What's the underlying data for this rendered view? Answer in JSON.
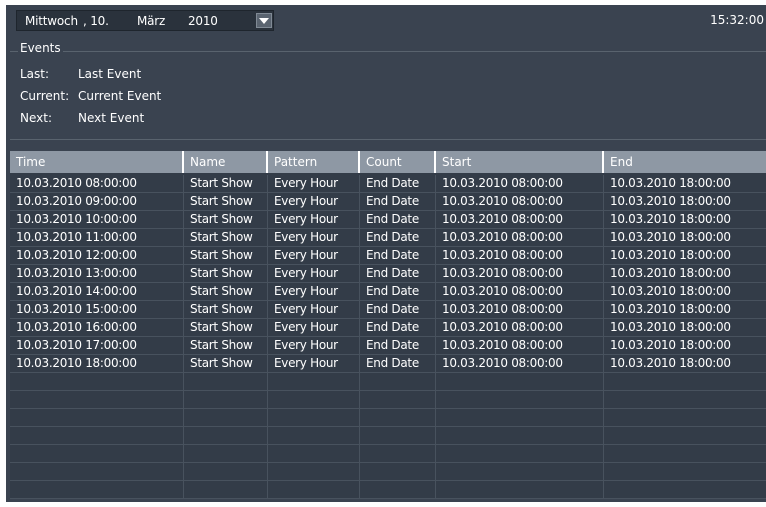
{
  "date": {
    "weekday": "Mittwoch",
    "day": ", 10.",
    "month": "März",
    "year": "2010"
  },
  "clock": "15:32:00",
  "events": {
    "title": "Events",
    "last": {
      "label": "Last:",
      "value": "Last Event"
    },
    "current": {
      "label": "Current:",
      "value": "Current Event"
    },
    "next": {
      "label": "Next:",
      "value": "Next Event"
    }
  },
  "table": {
    "columns": [
      "Time",
      "Name",
      "Pattern",
      "Count",
      "Start",
      "End"
    ],
    "rows": [
      [
        "10.03.2010 08:00:00",
        "Start Show",
        "Every Hour",
        "End Date",
        "10.03.2010 08:00:00",
        "10.03.2010 18:00:00"
      ],
      [
        "10.03.2010 09:00:00",
        "Start Show",
        "Every Hour",
        "End Date",
        "10.03.2010 08:00:00",
        "10.03.2010 18:00:00"
      ],
      [
        "10.03.2010 10:00:00",
        "Start Show",
        "Every Hour",
        "End Date",
        "10.03.2010 08:00:00",
        "10.03.2010 18:00:00"
      ],
      [
        "10.03.2010 11:00:00",
        "Start Show",
        "Every Hour",
        "End Date",
        "10.03.2010 08:00:00",
        "10.03.2010 18:00:00"
      ],
      [
        "10.03.2010 12:00:00",
        "Start Show",
        "Every Hour",
        "End Date",
        "10.03.2010 08:00:00",
        "10.03.2010 18:00:00"
      ],
      [
        "10.03.2010 13:00:00",
        "Start Show",
        "Every Hour",
        "End Date",
        "10.03.2010 08:00:00",
        "10.03.2010 18:00:00"
      ],
      [
        "10.03.2010 14:00:00",
        "Start Show",
        "Every Hour",
        "End Date",
        "10.03.2010 08:00:00",
        "10.03.2010 18:00:00"
      ],
      [
        "10.03.2010 15:00:00",
        "Start Show",
        "Every Hour",
        "End Date",
        "10.03.2010 08:00:00",
        "10.03.2010 18:00:00"
      ],
      [
        "10.03.2010 16:00:00",
        "Start Show",
        "Every Hour",
        "End Date",
        "10.03.2010 08:00:00",
        "10.03.2010 18:00:00"
      ],
      [
        "10.03.2010 17:00:00",
        "Start Show",
        "Every Hour",
        "End Date",
        "10.03.2010 08:00:00",
        "10.03.2010 18:00:00"
      ],
      [
        "10.03.2010 18:00:00",
        "Start Show",
        "Every Hour",
        "End Date",
        "10.03.2010 08:00:00",
        "10.03.2010 18:00:00"
      ]
    ],
    "empty_rows": 7
  },
  "colors": {
    "background": "#3a4350",
    "header": "#8e98a4",
    "text": "#ffffff"
  },
  "icons": {
    "dropdown": "chevron-down-icon"
  }
}
